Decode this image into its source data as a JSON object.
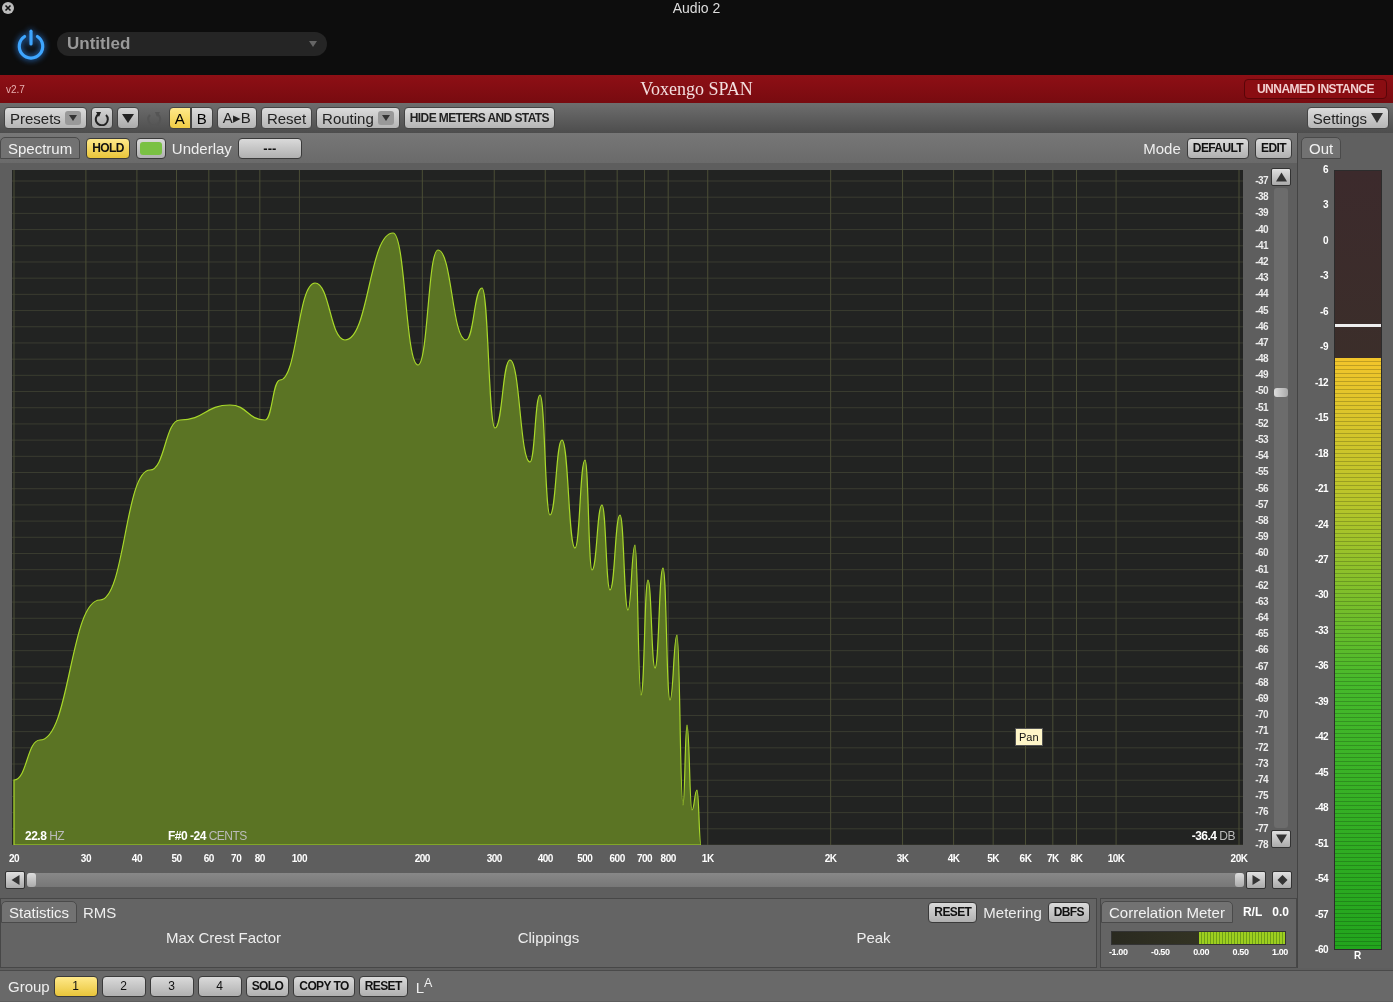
{
  "window": {
    "title": "Audio 2"
  },
  "host": {
    "power_on": true,
    "preset": "Untitled"
  },
  "header": {
    "version": "v2.7",
    "title": "Voxengo SPAN",
    "instance": "UNNAMED INSTANCE"
  },
  "toolbar": {
    "presets": "Presets",
    "history": [
      {
        "kind": "undo",
        "disabled": false
      },
      {
        "kind": "menu",
        "disabled": false
      },
      {
        "kind": "redo",
        "disabled": true
      }
    ],
    "ab": [
      {
        "label": "A",
        "selected": true
      },
      {
        "label": "B",
        "selected": false
      }
    ],
    "copy": "A▸B",
    "reset": "Reset",
    "routing": "Routing",
    "hide": "HIDE METERS AND STATS",
    "settings": "Settings"
  },
  "spectrum": {
    "tab": "Spectrum",
    "hold": {
      "label": "HOLD",
      "on": true
    },
    "color": "#7ac143",
    "underlay_label": "Underlay",
    "underlay": "---",
    "mode_label": "Mode",
    "mode": "DEFAULT",
    "edit": "EDIT",
    "db_labels": [
      "-37",
      "-38",
      "-39",
      "-40",
      "-41",
      "-42",
      "-43",
      "-44",
      "-45",
      "-46",
      "-47",
      "-48",
      "-49",
      "-50",
      "-51",
      "-52",
      "-53",
      "-54",
      "-55",
      "-56",
      "-57",
      "-58",
      "-59",
      "-60",
      "-61",
      "-62",
      "-63",
      "-64",
      "-65",
      "-66",
      "-67",
      "-68",
      "-69",
      "-70",
      "-71",
      "-72",
      "-73",
      "-74",
      "-75",
      "-76",
      "-77",
      "-78"
    ],
    "freq_labels": [
      "20",
      "30",
      "40",
      "50",
      "60",
      "70",
      "80",
      "100",
      "200",
      "300",
      "400",
      "500",
      "600",
      "700",
      "800",
      "1K",
      "2K",
      "3K",
      "4K",
      "5K",
      "6K",
      "7K",
      "8K",
      "10K",
      "20K"
    ],
    "readouts": [
      {
        "value": "22.8",
        "unit": "HZ"
      },
      {
        "value": "F#0 -24",
        "unit": "CENTS"
      },
      {
        "value": "-36.4",
        "unit": "DB"
      }
    ],
    "tooltip": "Pan"
  },
  "out": {
    "label": "Out",
    "scale": [
      "6",
      "3",
      "0",
      "-3",
      "-6",
      "-9",
      "-12",
      "-15",
      "-18",
      "-21",
      "-24",
      "-27",
      "-30",
      "-33",
      "-36",
      "-39",
      "-42",
      "-45",
      "-48",
      "-51",
      "-54",
      "-57",
      "-60"
    ],
    "level": 0.76,
    "peak": {
      "level": 0.8
    },
    "channel": "R"
  },
  "statistics": {
    "tab": "Statistics",
    "rms": "RMS",
    "reset": "RESET",
    "metering_label": "Metering",
    "metering": "DBFS",
    "fields": [
      "Max Crest Factor",
      "Clippings",
      "Peak"
    ]
  },
  "correlation": {
    "label": "Correlation Meter",
    "rl": "R/L",
    "value": "0.0",
    "level": 0.5,
    "ticks": [
      "-1.00",
      "-0.50",
      "0.00",
      "0.50",
      "1.00"
    ]
  },
  "group": {
    "label": "Group",
    "buttons": [
      {
        "label": "1",
        "selected": true
      },
      {
        "label": "2",
        "selected": false
      },
      {
        "label": "3",
        "selected": false
      },
      {
        "label": "4",
        "selected": false
      }
    ],
    "solo": "SOLO",
    "copy_to": "COPY TO",
    "reset": "RESET",
    "channel": "L$^{A}$"
  }
}
